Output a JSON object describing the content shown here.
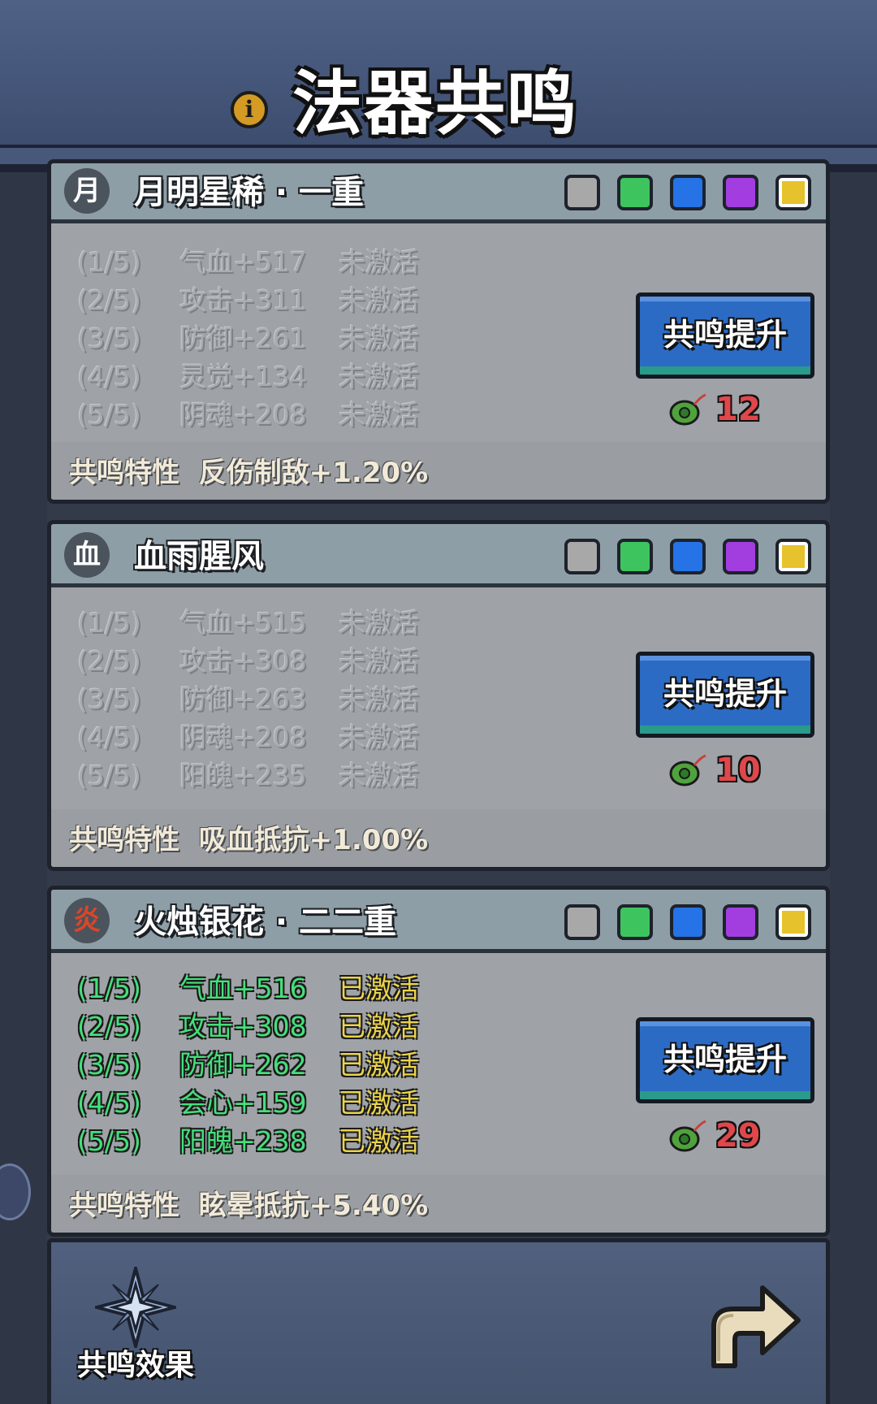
{
  "header": {
    "title": "法器共鸣",
    "info_icon": "info-icon"
  },
  "gem_colors": [
    "#a8a8a8",
    "#3ec45e",
    "#2573e6",
    "#a23de0",
    "#e6c22c"
  ],
  "cards": [
    {
      "icon_char": "月",
      "name": "月明星稀 · 一重",
      "selected_gem": 4,
      "active": false,
      "rows": [
        {
          "level": "(1/5)",
          "stat": "气血+517",
          "state": "未激活"
        },
        {
          "level": "(2/5)",
          "stat": "攻击+311",
          "state": "未激活"
        },
        {
          "level": "(3/5)",
          "stat": "防御+261",
          "state": "未激活"
        },
        {
          "level": "(4/5)",
          "stat": "灵觉+134",
          "state": "未激活"
        },
        {
          "level": "(5/5)",
          "stat": "阴魂+208",
          "state": "未激活"
        }
      ],
      "trait_label": "共鸣特性",
      "trait_value": "反伤制敌+1.20%",
      "button_label": "共鸣提升",
      "cost": "12"
    },
    {
      "icon_char": "血",
      "name": "血雨腥风",
      "selected_gem": 4,
      "active": false,
      "rows": [
        {
          "level": "(1/5)",
          "stat": "气血+515",
          "state": "未激活"
        },
        {
          "level": "(2/5)",
          "stat": "攻击+308",
          "state": "未激活"
        },
        {
          "level": "(3/5)",
          "stat": "防御+263",
          "state": "未激活"
        },
        {
          "level": "(4/5)",
          "stat": "阴魂+208",
          "state": "未激活"
        },
        {
          "level": "(5/5)",
          "stat": "阳魄+235",
          "state": "未激活"
        }
      ],
      "trait_label": "共鸣特性",
      "trait_value": "吸血抵抗+1.00%",
      "button_label": "共鸣提升",
      "cost": "10"
    },
    {
      "icon_char": "炎",
      "name": "火烛银花 · 二二重",
      "selected_gem": 4,
      "active": true,
      "rows": [
        {
          "level": "(1/5)",
          "stat": "气血+516",
          "state": "已激活"
        },
        {
          "level": "(2/5)",
          "stat": "攻击+308",
          "state": "已激活"
        },
        {
          "level": "(3/5)",
          "stat": "防御+262",
          "state": "已激活"
        },
        {
          "level": "(4/5)",
          "stat": "会心+159",
          "state": "已激活"
        },
        {
          "level": "(5/5)",
          "stat": "阳魄+238",
          "state": "已激活"
        }
      ],
      "trait_label": "共鸣特性",
      "trait_value": "眩晕抵抗+5.40%",
      "button_label": "共鸣提升",
      "cost": "29"
    }
  ],
  "footer": {
    "effect_label": "共鸣效果",
    "effect_icon": "star-compass-icon",
    "back_icon": "return-arrow-icon"
  }
}
